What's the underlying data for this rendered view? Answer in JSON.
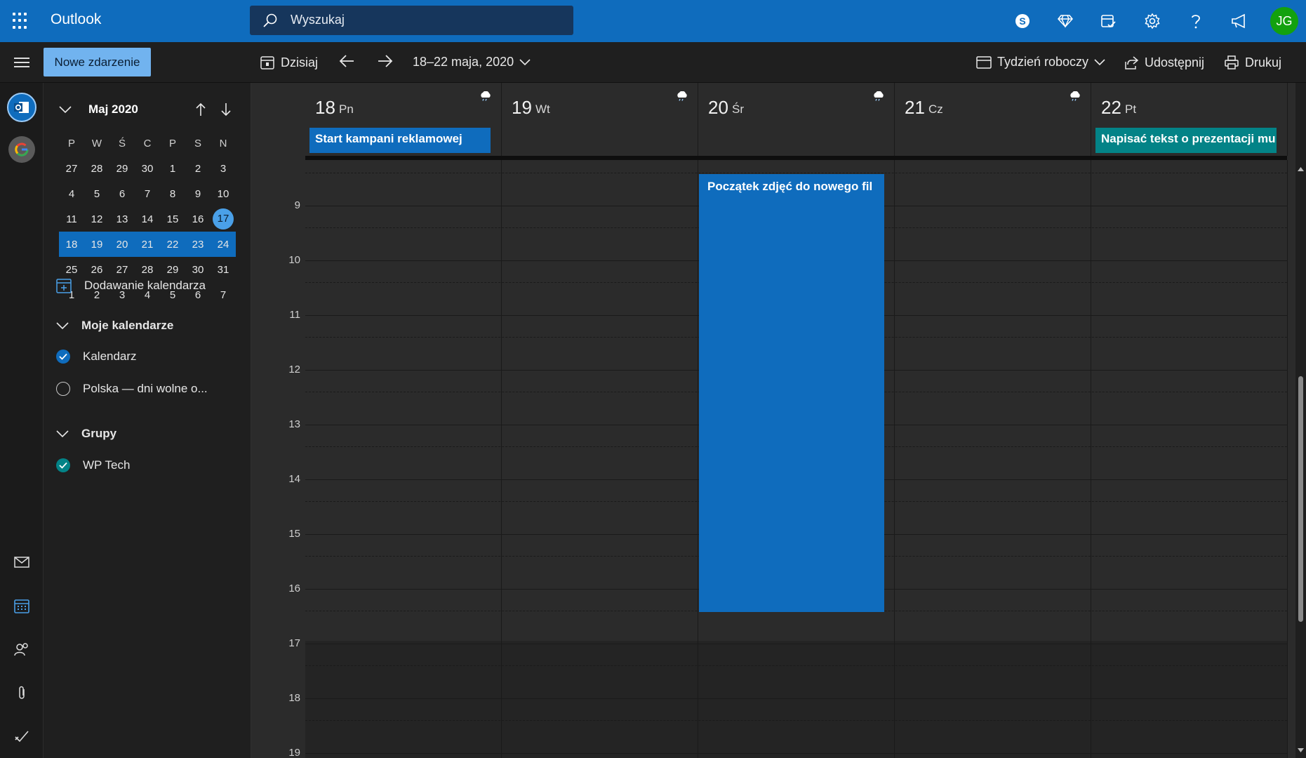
{
  "app": {
    "title": "Outlook"
  },
  "search": {
    "placeholder": "Wyszukaj"
  },
  "topbar_icons": [
    "skype-icon",
    "premium-diamond-icon",
    "tasks-icon",
    "settings-gear-icon",
    "help-icon",
    "feedback-megaphone-icon"
  ],
  "user": {
    "initials": "JG",
    "avatar_color": "#13a10e"
  },
  "toolbar": {
    "new_event": "Nowe zdarzenie",
    "today": "Dzisiaj",
    "date_range": "18–22 maja, 2020",
    "view": "Tydzień roboczy",
    "share": "Udostępnij",
    "print": "Drukuj"
  },
  "mini_calendar": {
    "month": "Maj 2020",
    "days_of_week": [
      "P",
      "W",
      "Ś",
      "C",
      "P",
      "S",
      "N"
    ],
    "weeks": [
      [
        "27",
        "28",
        "29",
        "30",
        "1",
        "2",
        "3"
      ],
      [
        "4",
        "5",
        "6",
        "7",
        "8",
        "9",
        "10"
      ],
      [
        "11",
        "12",
        "13",
        "14",
        "15",
        "16",
        "17"
      ],
      [
        "18",
        "19",
        "20",
        "21",
        "22",
        "23",
        "24"
      ],
      [
        "25",
        "26",
        "27",
        "28",
        "29",
        "30",
        "31"
      ],
      [
        "1",
        "2",
        "3",
        "4",
        "5",
        "6",
        "7"
      ]
    ],
    "today": "17",
    "selected_week_index": 3
  },
  "folder_pane": {
    "add_calendar": "Dodawanie kalendarza",
    "my_calendars": "Moje kalendarze",
    "calendars": [
      {
        "label": "Kalendarz",
        "checked": true,
        "color": "#0f6cbd"
      },
      {
        "label": "Polska — dni wolne o...",
        "checked": false,
        "color": "#c8c8c8"
      }
    ],
    "groups": "Grupy",
    "group_items": [
      {
        "label": "WP Tech",
        "checked": true,
        "color": "#038387"
      }
    ]
  },
  "days": [
    {
      "num": "18",
      "name": "Pn",
      "weather": true
    },
    {
      "num": "19",
      "name": "Wt",
      "weather": true
    },
    {
      "num": "20",
      "name": "Śr",
      "weather": true
    },
    {
      "num": "21",
      "name": "Cz",
      "weather": true
    },
    {
      "num": "22",
      "name": "Pt",
      "weather": false
    }
  ],
  "allday_events": [
    {
      "day": "18",
      "title": "Start kampani reklamowej",
      "color": "#0f6cbd"
    },
    {
      "day": "22",
      "title": "Napisać tekst o prezentacji mu",
      "color": "#038387"
    }
  ],
  "hours": [
    "9",
    "10",
    "11",
    "12",
    "13",
    "14",
    "15",
    "16",
    "17",
    "18",
    "19"
  ],
  "events": [
    {
      "day": "20",
      "title": "Początek zdjęć do nowego fil",
      "start": "8:30",
      "end": "16:30",
      "color": "#0f6cbd"
    }
  ]
}
